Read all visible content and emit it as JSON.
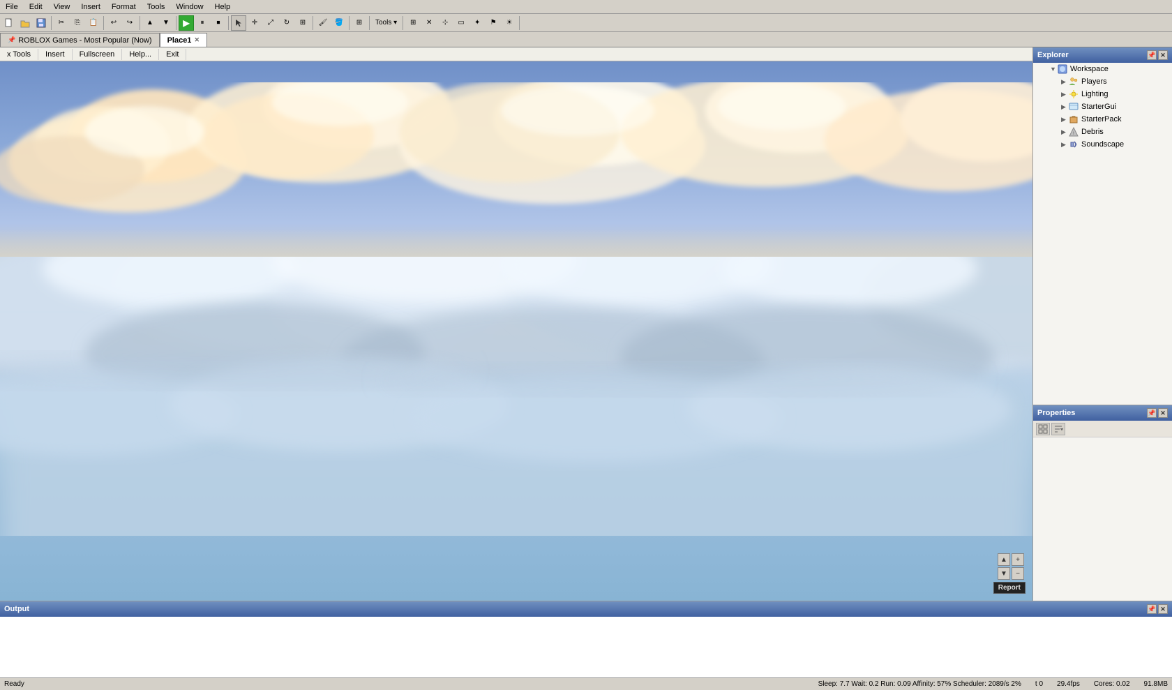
{
  "menubar": {
    "items": [
      "File",
      "Edit",
      "View",
      "Insert",
      "Format",
      "Tools",
      "Window",
      "Help"
    ]
  },
  "tabbar": {
    "tabs": [
      {
        "id": "roblox-games",
        "label": "ROBLOX Games - Most Popular (Now)",
        "active": false,
        "pinned": true
      },
      {
        "id": "place1",
        "label": "Place1",
        "active": true
      }
    ]
  },
  "game_toolbar": {
    "items": [
      "x Tools",
      "Insert",
      "Fullscreen",
      "Help...",
      "Exit"
    ]
  },
  "explorer": {
    "title": "Explorer",
    "items": [
      {
        "id": "workspace",
        "label": "Workspace",
        "indent": 1,
        "expanded": true,
        "icon": "workspace"
      },
      {
        "id": "players",
        "label": "Players",
        "indent": 2,
        "expanded": false,
        "icon": "players"
      },
      {
        "id": "lighting",
        "label": "Lighting",
        "indent": 2,
        "expanded": false,
        "icon": "lighting"
      },
      {
        "id": "startergui",
        "label": "StarterGui",
        "indent": 2,
        "expanded": false,
        "icon": "startergui"
      },
      {
        "id": "starterpack",
        "label": "StarterPack",
        "indent": 2,
        "expanded": false,
        "icon": "starterpack"
      },
      {
        "id": "debris",
        "label": "Debris",
        "indent": 2,
        "expanded": false,
        "icon": "debris"
      },
      {
        "id": "soundscape",
        "label": "Soundscape",
        "indent": 2,
        "expanded": false,
        "icon": "soundscape"
      }
    ]
  },
  "properties": {
    "title": "Properties"
  },
  "output": {
    "title": "Output"
  },
  "statusbar": {
    "left": "Ready",
    "stats": "Sleep: 7.7  Wait: 0.2  Run: 0.09  Affinity: 57%  Scheduler: 2089/s 2%",
    "time": "t 0",
    "fps": "29.4fps",
    "cores": "Cores: 0.02",
    "memory": "91.8MB"
  },
  "report_btn": "Report",
  "toolbar": {
    "play_label": "▶",
    "pause_label": "⏸",
    "stop_label": "⏹",
    "tools_label": "Tools ▾"
  }
}
